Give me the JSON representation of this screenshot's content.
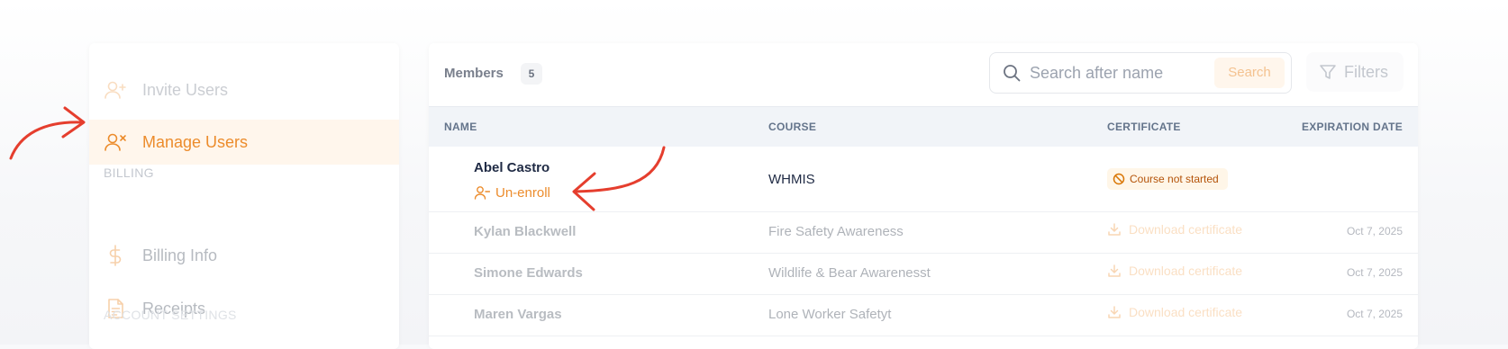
{
  "sidebar": {
    "items": [
      {
        "label": "Invite Users",
        "icon": "user-plus-icon"
      },
      {
        "label": "Manage Users",
        "icon": "user-x-icon",
        "active": true
      },
      {
        "label": "Billing Info",
        "icon": "dollar-icon"
      },
      {
        "label": "Receipts",
        "icon": "receipt-icon"
      }
    ],
    "sections": {
      "billing": "BILLING",
      "account": "ACCOUNT SETTINGS"
    }
  },
  "members": {
    "label": "Members",
    "count": "5"
  },
  "search": {
    "placeholder": "Search after name",
    "button_label": "Search"
  },
  "filters": {
    "label": "Filters"
  },
  "table": {
    "headers": {
      "name": "NAME",
      "course": "COURSE",
      "certificate": "CERTIFICATE",
      "expiration": "EXPIRATION DATE"
    },
    "main_row": {
      "name": "Abel Castro",
      "action": "Un-enroll",
      "course": "WHMIS",
      "status": "Course not started"
    },
    "rows": [
      {
        "name": "Kylan Blackwell",
        "course": "Fire Safety Awareness",
        "certificate": "Download certificate",
        "expiration": "Oct 7, 2025"
      },
      {
        "name": "Simone Edwards",
        "course": "Wildlife & Bear Awarenesst",
        "certificate": "Download certificate",
        "expiration": "Oct 7, 2025"
      },
      {
        "name": "Maren Vargas",
        "course": "Lone Worker Safetyt",
        "certificate": "Download certificate",
        "expiration": "Oct 7, 2025"
      }
    ]
  },
  "colors": {
    "accent": "#ec8c2c",
    "annotation": "#e53e2e",
    "status_text": "#b45309"
  }
}
